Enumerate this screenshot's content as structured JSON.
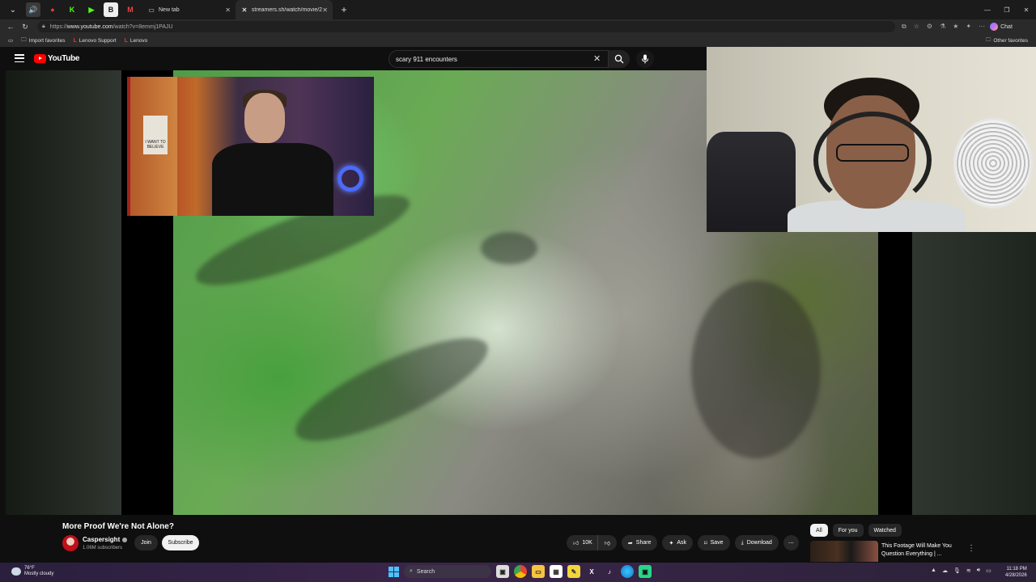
{
  "browser": {
    "tabs": [
      {
        "label": "New tab",
        "active": false
      },
      {
        "label": "streamers.sh/watch/movie/285?se",
        "active": true
      }
    ],
    "url_prefix": "https://",
    "url_host": "www.youtube.com",
    "url_path": "/watch?v=8emmj1PAJU",
    "favorites": [
      {
        "label": "Import favorites"
      },
      {
        "label": "Lenovo Support"
      },
      {
        "label": "Lenovo"
      }
    ],
    "other_favorites": "Other favorites",
    "chat_label": "Chat"
  },
  "youtube": {
    "logo_text": "YouTube",
    "search_query": "scary 911 encounters",
    "video": {
      "title": "More Proof We're Not Alone?",
      "channel": "Caspersight",
      "subscribers": "1.06M subscribers",
      "join_label": "Join",
      "subscribe_label": "Subscribe",
      "likes": "10K",
      "share_label": "Share",
      "ask_label": "Ask",
      "save_label": "Save",
      "download_label": "Download"
    },
    "chips": [
      {
        "label": "All",
        "active": true
      },
      {
        "label": "For you",
        "active": false
      },
      {
        "label": "Watched",
        "active": false
      }
    ],
    "recommendation": {
      "title_line1": "This Footage Will Make You",
      "title_line2": "Question Everything | ..."
    }
  },
  "overlay": {
    "poster_text": "I WANT TO BELIEVE"
  },
  "taskbar": {
    "weather_temp": "76°F",
    "weather_desc": "Mostly cloudy",
    "search_label": "Search",
    "time": "11:18 PM",
    "date": "4/28/2026"
  },
  "colors": {
    "youtube_red": "#ff0000",
    "background": "#0f0f0f",
    "button_bg": "#272727"
  }
}
